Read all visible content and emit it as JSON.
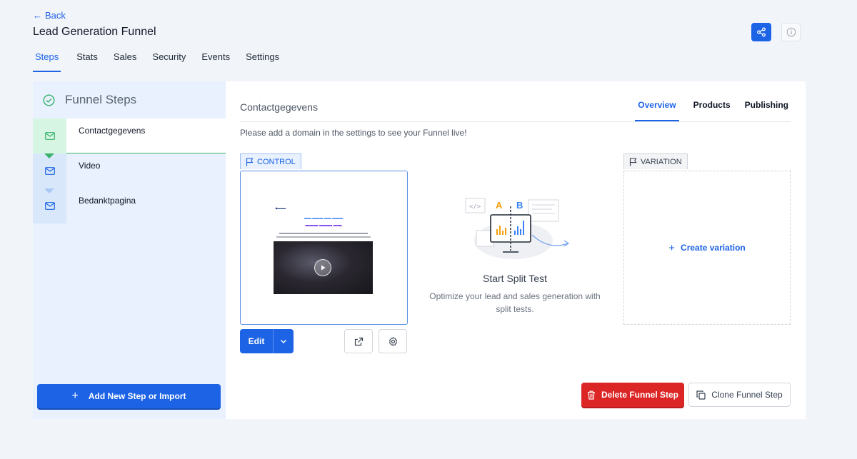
{
  "header": {
    "back_label": "Back",
    "title": "Lead Generation Funnel"
  },
  "tabs": [
    {
      "label": "Steps",
      "active": true
    },
    {
      "label": "Stats"
    },
    {
      "label": "Sales"
    },
    {
      "label": "Security"
    },
    {
      "label": "Events"
    },
    {
      "label": "Settings"
    }
  ],
  "sidebar": {
    "title": "Funnel Steps",
    "steps": [
      {
        "label": "Contactgegevens",
        "active": true
      },
      {
        "label": "Video"
      },
      {
        "label": "Bedanktpagina"
      }
    ],
    "add_button": "Add New Step or Import"
  },
  "main": {
    "title": "Contactgegevens",
    "tabs": [
      {
        "label": "Overview",
        "active": true
      },
      {
        "label": "Products"
      },
      {
        "label": "Publishing"
      }
    ],
    "domain_note": "Please add a domain in the settings to see your Funnel live!",
    "control_badge": "CONTROL",
    "variation_badge": "VARIATION",
    "edit_label": "Edit",
    "split_test": {
      "title": "Start Split Test",
      "description": "Optimize your lead and sales generation with split tests.",
      "label_a": "A",
      "label_b": "B"
    },
    "create_variation": "Create variation",
    "delete_label": "Delete Funnel Step",
    "clone_label": "Clone Funnel Step"
  },
  "colors": {
    "accent": "#1d63e6",
    "danger": "#dc2626",
    "success": "#36b26a"
  }
}
